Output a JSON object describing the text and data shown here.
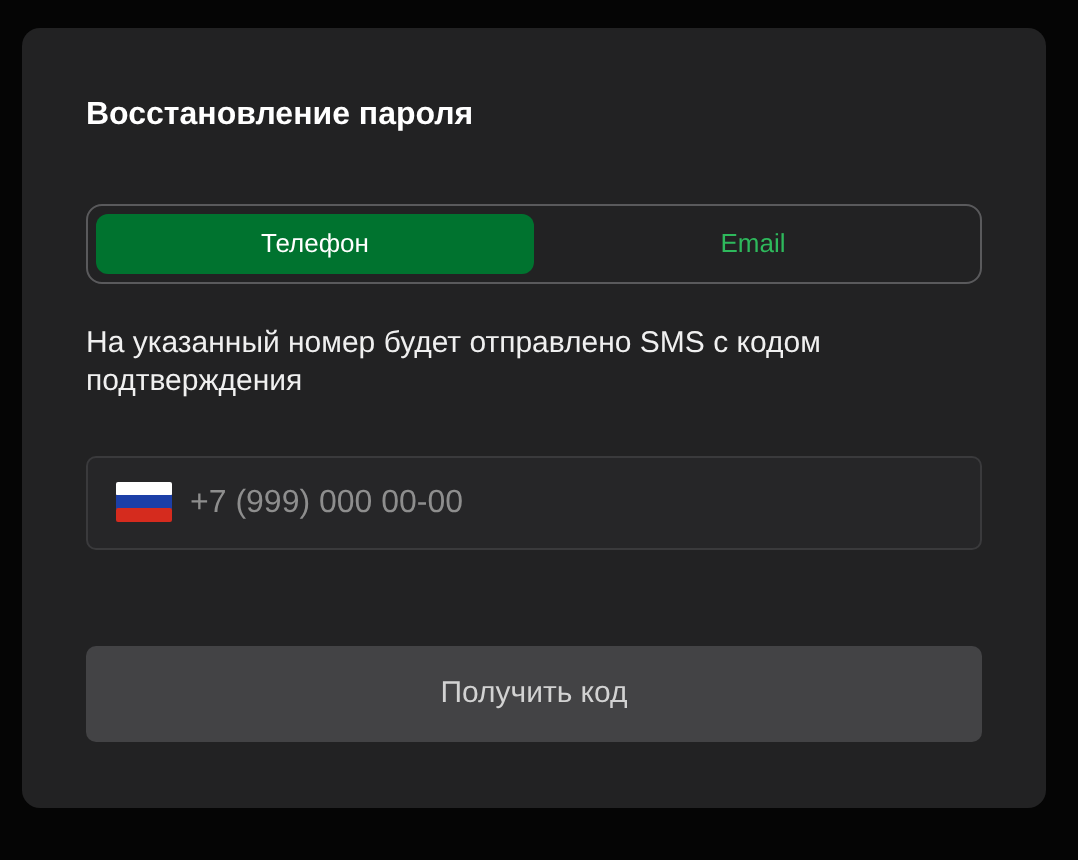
{
  "title": "Восстановление пароля",
  "tabs": [
    {
      "label": "Телефон",
      "selected": true
    },
    {
      "label": "Email",
      "selected": false
    }
  ],
  "description": "На указанный номер будет отправлено SMS с кодом подтверждения",
  "phone_field": {
    "placeholder": "+7 (999) 000 00-00"
  },
  "submit_button": {
    "label": "Получить код",
    "disabled": true
  }
}
